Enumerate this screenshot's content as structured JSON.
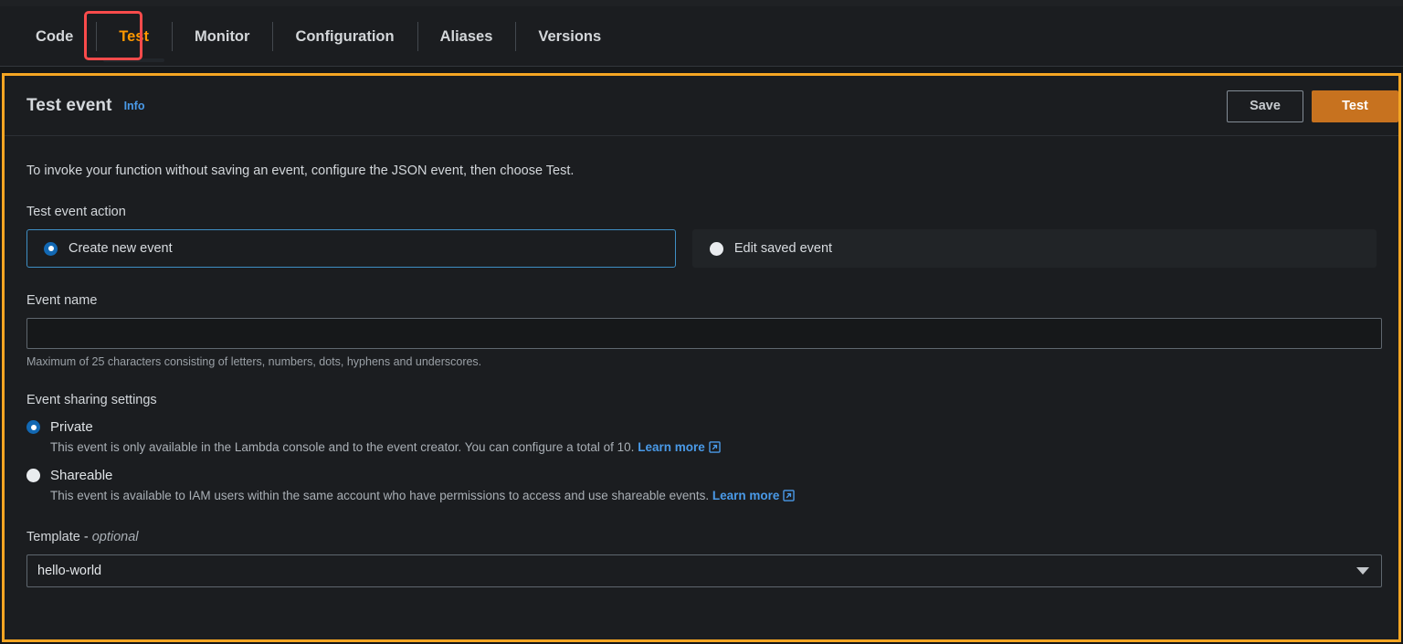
{
  "tabs": [
    {
      "label": "Code",
      "active": false
    },
    {
      "label": "Test",
      "active": true
    },
    {
      "label": "Monitor",
      "active": false
    },
    {
      "label": "Configuration",
      "active": false
    },
    {
      "label": "Aliases",
      "active": false
    },
    {
      "label": "Versions",
      "active": false
    }
  ],
  "annotation": {
    "target": "Test",
    "color": "#fa4b4b"
  },
  "panel": {
    "title": "Test event",
    "info_label": "Info",
    "save_label": "Save",
    "test_label": "Test",
    "accent_color": "#f5a623",
    "primary_button_color": "#c7721f",
    "intro": "To invoke your function without saving an event, configure the JSON event, then choose Test."
  },
  "test_event_action": {
    "label": "Test event action",
    "options": [
      {
        "label": "Create new event",
        "selected": true
      },
      {
        "label": "Edit saved event",
        "selected": false
      }
    ]
  },
  "event_name": {
    "label": "Event name",
    "value": "",
    "placeholder": "",
    "hint": "Maximum of 25 characters consisting of letters, numbers, dots, hyphens and underscores."
  },
  "event_sharing": {
    "label": "Event sharing settings",
    "options": [
      {
        "label": "Private",
        "selected": true,
        "description": "This event is only available in the Lambda console and to the event creator. You can configure a total of 10.",
        "link_label": "Learn more"
      },
      {
        "label": "Shareable",
        "selected": false,
        "description": "This event is available to IAM users within the same account who have permissions to access and use shareable events.",
        "link_label": "Learn more"
      }
    ]
  },
  "template": {
    "label": "Template - ",
    "label_optional": "optional",
    "value": "hello-world"
  }
}
